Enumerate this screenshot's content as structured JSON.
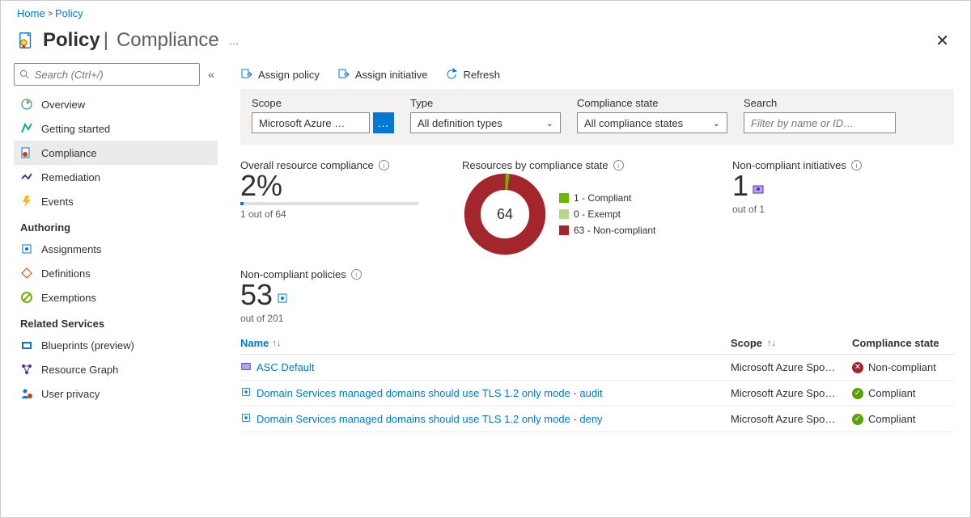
{
  "breadcrumb": {
    "home": "Home",
    "policy": "Policy"
  },
  "header": {
    "title_main": "Policy",
    "title_sub": "Compliance"
  },
  "sidebar": {
    "search_placeholder": "Search (Ctrl+/)",
    "items": [
      {
        "label": "Overview"
      },
      {
        "label": "Getting started"
      },
      {
        "label": "Compliance",
        "active": true
      },
      {
        "label": "Remediation"
      },
      {
        "label": "Events"
      }
    ],
    "section_authoring": "Authoring",
    "authoring_items": [
      {
        "label": "Assignments"
      },
      {
        "label": "Definitions"
      },
      {
        "label": "Exemptions"
      }
    ],
    "section_related": "Related Services",
    "related_items": [
      {
        "label": "Blueprints (preview)"
      },
      {
        "label": "Resource Graph"
      },
      {
        "label": "User privacy"
      }
    ]
  },
  "toolbar": {
    "assign_policy": "Assign policy",
    "assign_initiative": "Assign initiative",
    "refresh": "Refresh"
  },
  "filters": {
    "scope_label": "Scope",
    "scope_value": "Microsoft Azure …",
    "type_label": "Type",
    "type_value": "All definition types",
    "state_label": "Compliance state",
    "state_value": "All compliance states",
    "search_label": "Search",
    "search_placeholder": "Filter by name or ID…"
  },
  "overall": {
    "title": "Overall resource compliance",
    "percent_display": "2%",
    "percent_value": 2,
    "sub": "1 out of 64"
  },
  "donut": {
    "title": "Resources by compliance state",
    "total": "64",
    "legend": {
      "compliant": "1 - Compliant",
      "exempt": "0 - Exempt",
      "noncompliant": "63 - Non-compliant"
    },
    "colors": {
      "compliant": "#6bb700",
      "exempt": "#b5d98a",
      "noncompliant": "#a4262c"
    }
  },
  "nc_initiatives": {
    "title": "Non-compliant initiatives",
    "value": "1",
    "sub": "out of 1"
  },
  "nc_policies": {
    "title": "Non-compliant policies",
    "value": "53",
    "sub": "out of 201"
  },
  "table": {
    "headers": {
      "name": "Name",
      "scope": "Scope",
      "state": "Compliance state"
    },
    "rows": [
      {
        "name": "ASC Default",
        "scope": "Microsoft Azure Spo…",
        "state": "Non-compliant",
        "ok": false
      },
      {
        "name": "Domain Services managed domains should use TLS 1.2 only mode - audit",
        "scope": "Microsoft Azure Spo…",
        "state": "Compliant",
        "ok": true
      },
      {
        "name": "Domain Services managed domains should use TLS 1.2 only mode - deny",
        "scope": "Microsoft Azure Spo…",
        "state": "Compliant",
        "ok": true
      }
    ]
  },
  "chart_data": {
    "type": "pie",
    "title": "Resources by compliance state",
    "categories": [
      "Compliant",
      "Exempt",
      "Non-compliant"
    ],
    "values": [
      1,
      0,
      63
    ],
    "total": 64
  }
}
